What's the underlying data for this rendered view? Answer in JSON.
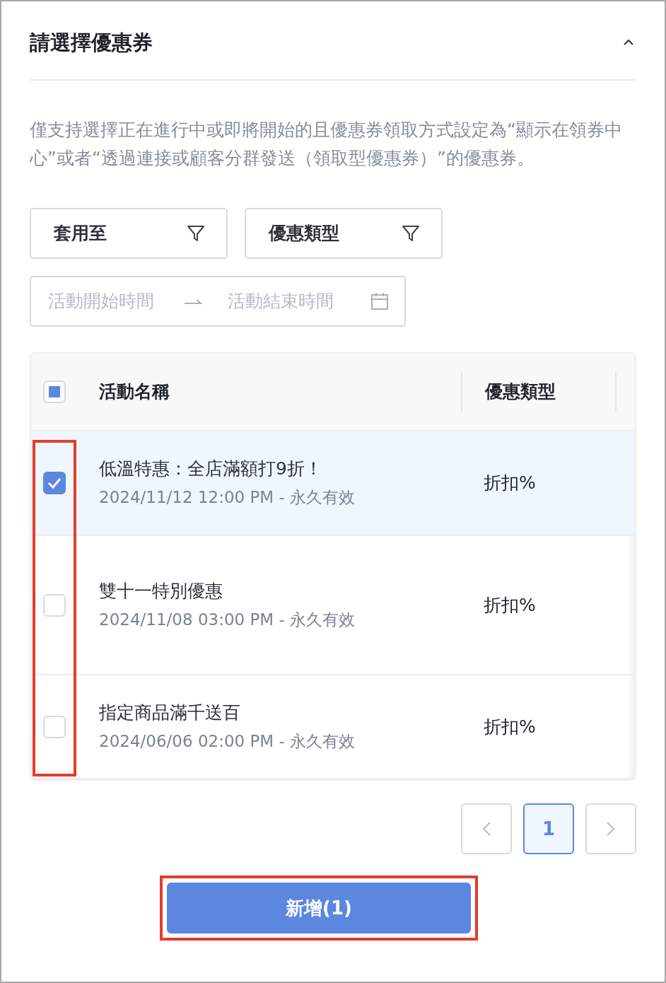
{
  "panel": {
    "title": "請選擇優惠券",
    "expanded": true
  },
  "description": "僅支持選擇正在進行中或即將開始的且優惠券領取方式設定為“顯示在領券中心”或者“透過連接或顧客分群發送（領取型優惠券）”的優惠券。",
  "filters": [
    {
      "label": "套用至"
    },
    {
      "label": "優惠類型"
    }
  ],
  "date_range": {
    "start_placeholder": "活動開始時間",
    "end_placeholder": "活動結束時間"
  },
  "table": {
    "select_all": {
      "checked": false,
      "indeterminate": true
    },
    "columns": [
      "活動名稱",
      "優惠類型"
    ],
    "rows": [
      {
        "name": "低溫特惠：全店滿額打9折！",
        "period": "2024/11/12 12:00 PM - 永久有效",
        "type": "折扣%",
        "selected": true
      },
      {
        "name": "雙十一特別優惠",
        "period": "2024/11/08 03:00 PM - 永久有效",
        "type": "折扣%",
        "selected": false
      },
      {
        "name": "指定商品滿千送百",
        "period": "2024/06/06 02:00 PM - 永久有效",
        "type": "折扣%",
        "selected": false
      }
    ]
  },
  "pagination": {
    "pages": [
      {
        "label": "1",
        "selected": true
      }
    ]
  },
  "add_button": {
    "label": "新增(1)"
  },
  "highlights": {
    "checkbox_column": true,
    "add_button": true
  }
}
